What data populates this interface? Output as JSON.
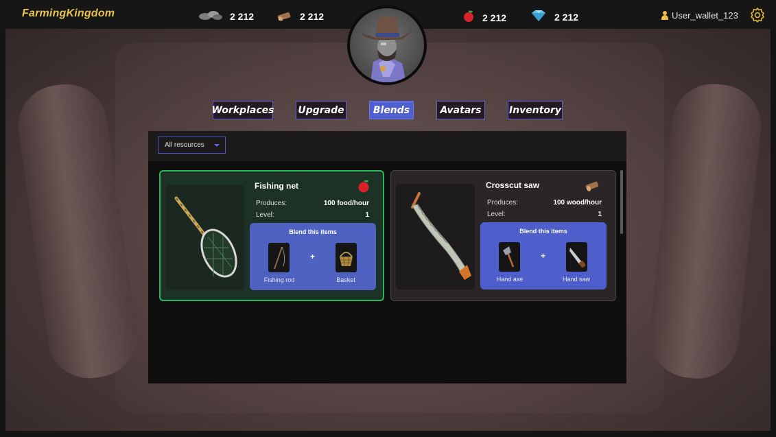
{
  "app": {
    "title": "FarmingKingdom"
  },
  "resources": [
    {
      "name": "stone-icon",
      "value": "2 212"
    },
    {
      "name": "wood-icon",
      "value": "2 212"
    },
    {
      "name": "apple-icon",
      "value": "2 212"
    },
    {
      "name": "diamond-icon",
      "value": "2 212"
    }
  ],
  "user": {
    "wallet": "User_wallet_123"
  },
  "tabs": [
    {
      "label": "Workplaces"
    },
    {
      "label": "Upgrade"
    },
    {
      "label": "Blends",
      "active": true
    },
    {
      "label": "Avatars"
    },
    {
      "label": "Inventory"
    }
  ],
  "filter": {
    "selected": "All resources"
  },
  "cards": [
    {
      "title": "Fishing net",
      "resource_icon": "apple-icon",
      "produces_label": "Produces:",
      "produces_value": "100 food/hour",
      "level_label": "Level:",
      "level_value": "1",
      "blend_title": "Blend this items",
      "plus": "+",
      "item1": "Fishing rod",
      "item2": "Basket",
      "selected": true
    },
    {
      "title": "Crosscut saw",
      "resource_icon": "wood-icon",
      "produces_label": "Produces:",
      "produces_value": "100 wood/hour",
      "level_label": "Level:",
      "level_value": "1",
      "blend_title": "Blend this items",
      "plus": "+",
      "item1": "Hand axe",
      "item2": "Hand saw",
      "selected": false
    }
  ],
  "colors": {
    "accent": "#5060d0",
    "selected_border": "#2db45a",
    "logo": "#e8c24a"
  }
}
